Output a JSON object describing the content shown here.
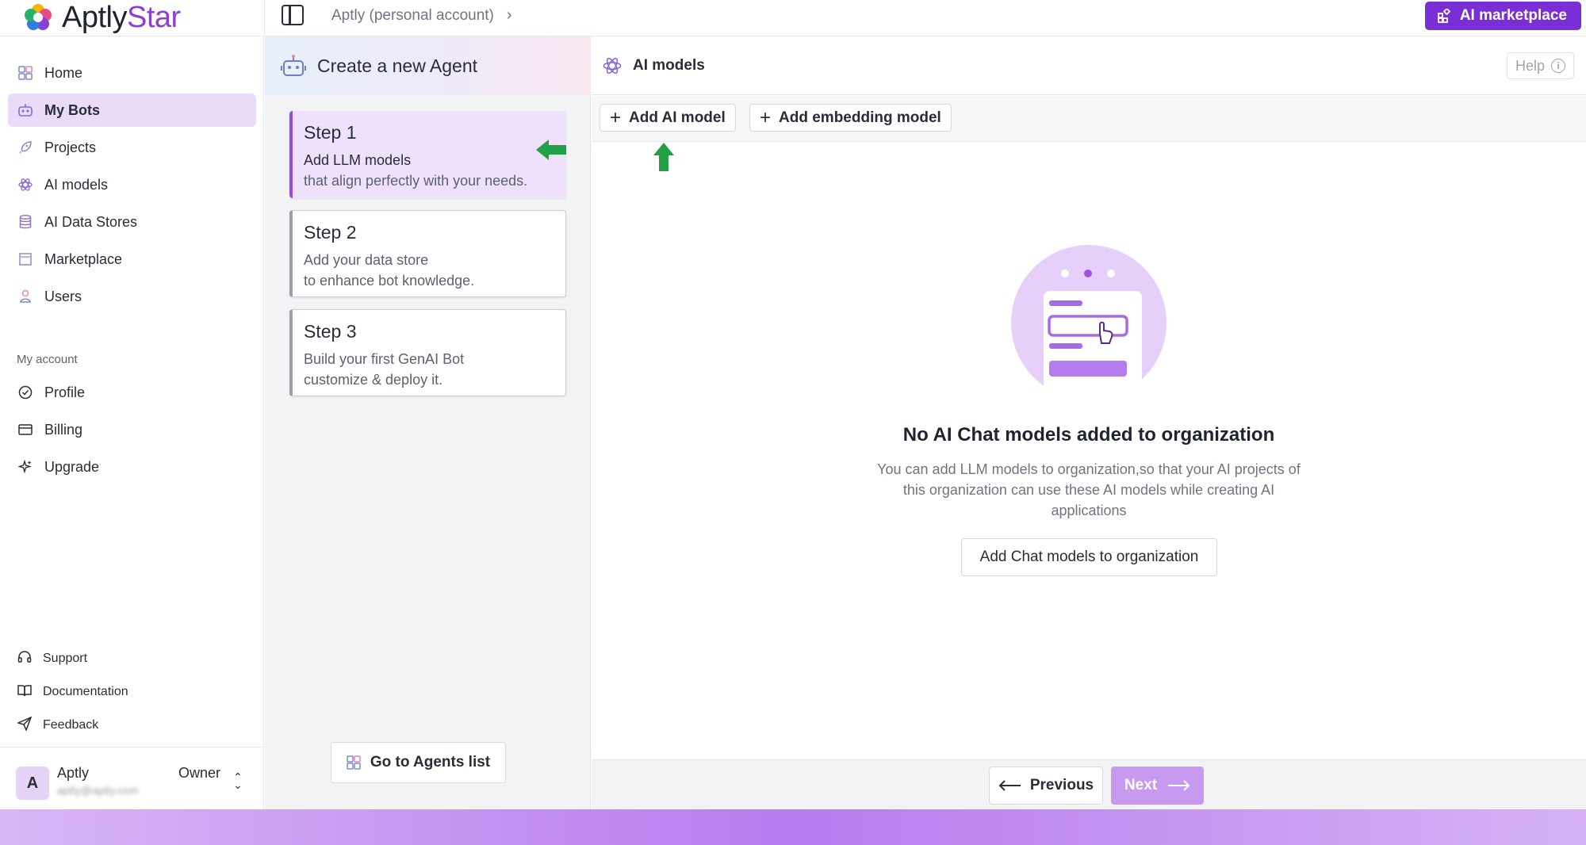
{
  "app": {
    "logo_part1": "Aptly",
    "logo_part2": "Star",
    "breadcrumb": "Aptly (personal account)",
    "breadcrumb_chevron": "›",
    "marketplace_button": "AI marketplace"
  },
  "sidebar": {
    "items": [
      {
        "label": "Home",
        "icon": "grid-icon"
      },
      {
        "label": "My Bots",
        "icon": "bot-icon",
        "active": true
      },
      {
        "label": "Projects",
        "icon": "rocket-icon"
      },
      {
        "label": "AI models",
        "icon": "atom-icon"
      },
      {
        "label": "AI Data Stores",
        "icon": "database-icon"
      },
      {
        "label": "Marketplace",
        "icon": "store-icon"
      },
      {
        "label": "Users",
        "icon": "user-icon"
      }
    ],
    "section_label": "My account",
    "account_items": [
      {
        "label": "Profile",
        "icon": "badge-check-icon"
      },
      {
        "label": "Billing",
        "icon": "card-icon"
      },
      {
        "label": "Upgrade",
        "icon": "sparkles-icon"
      }
    ],
    "bottom_items": [
      {
        "label": "Support",
        "icon": "headset-icon"
      },
      {
        "label": "Documentation",
        "icon": "book-icon"
      },
      {
        "label": "Feedback",
        "icon": "send-icon"
      }
    ],
    "user": {
      "initial": "A",
      "name": "Aptly",
      "email": "aptly@aptly.com",
      "role": "Owner"
    }
  },
  "steps_panel": {
    "title": "Create a new Agent",
    "steps": [
      {
        "title": "Step 1",
        "line1": "Add LLM models",
        "line2": "that align perfectly with your needs."
      },
      {
        "title": "Step 2",
        "line1": "Add your data store",
        "line2": "to enhance bot knowledge."
      },
      {
        "title": "Step 3",
        "line1": "Build your first GenAI Bot",
        "line2": "customize & deploy it."
      }
    ],
    "go_button": "Go to Agents list"
  },
  "main": {
    "title": "AI models",
    "help": "Help",
    "add_ai_model": "Add AI model",
    "add_embedding_model": "Add embedding model",
    "empty_title": "No AI Chat models added to organization",
    "empty_desc": "You can add LLM models to organization,so that your AI projects of this organization can use these AI models while creating AI applications",
    "empty_button": "Add Chat models to organization",
    "prev": "Previous",
    "next": "Next"
  },
  "colors": {
    "accent": "#7a2fd6",
    "active_bg": "#eadcf9",
    "hint_arrow": "#22a045"
  }
}
